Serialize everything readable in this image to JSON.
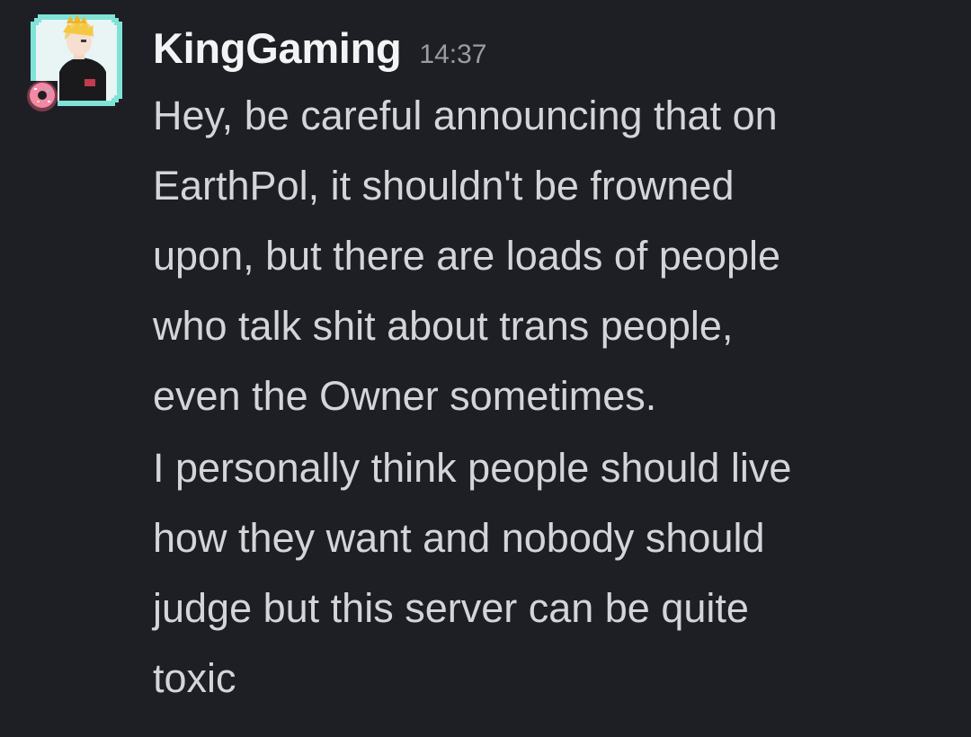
{
  "message": {
    "username": "KingGaming",
    "timestamp": "14:37",
    "avatar_icon": "anime-character-avatar-icon",
    "badge_icon": "donut-icon",
    "paragraphs": [
      {
        "lines": [
          "Hey, be careful announcing that on",
          "EarthPol, it shouldn't be frowned",
          "upon, but there are loads of people",
          "who talk shit about trans people,",
          "even the Owner sometimes."
        ]
      },
      {
        "lines": [
          "I personally think people should live",
          "how they want and nobody should",
          "judge but this server can be quite",
          "toxic"
        ]
      }
    ]
  },
  "colors": {
    "background": "#1e1f24",
    "username": "#f2f3f5",
    "timestamp": "#9a9ca3",
    "text": "#d4d5d9",
    "avatar_ring": "#7fe3d8"
  }
}
